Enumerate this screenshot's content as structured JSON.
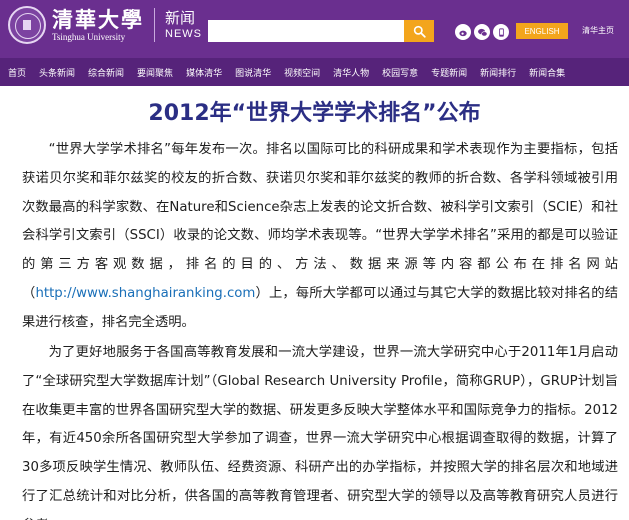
{
  "header": {
    "logo_cn": "清華大學",
    "logo_en": "Tsinghua University",
    "section_cn": "新闻",
    "section_en": "NEWS",
    "search_placeholder": "",
    "english_label": "ENGLISH",
    "home_link": "清华主页",
    "social_icons": [
      "weibo-icon",
      "wechat-icon",
      "mobile-icon"
    ],
    "colors": {
      "brand": "#6a2f8f",
      "nav": "#56237a",
      "accent": "#f3a51c"
    }
  },
  "nav": {
    "items": [
      "首页",
      "头条新闻",
      "综合新闻",
      "要闻聚焦",
      "媒体清华",
      "图说清华",
      "视频空间",
      "清华人物",
      "校园写意",
      "专题新闻",
      "新闻排行",
      "新闻合集"
    ]
  },
  "article": {
    "title": "2012年“世界大学学术排名”公布",
    "p1_before_link": "“世界大学学术排名”每年发布一次。排名以国际可比的科研成果和学术表现作为主要指标，包括获诺贝尔奖和菲尔兹奖的校友的折合数、获诺贝尔奖和菲尔兹奖的教师的折合数、各学科领域被引用次数最高的科学家数、在Nature和Science杂志上发表的论文折合数、被科学引文索引（SCIE）和社会科学引文索引（SSCI）收录的论文数、师均学术表现等。“世界大学学术排名”采用的都是可以验证的第三方客观数据，排名的目的、方法、数据来源等内容都公布在排名网站（",
    "p1_link": "http://www.shanghairanking.com",
    "p1_after_link": "）上，每所大学都可以通过与其它大学的数据比较对排名的结果进行核查，排名完全透明。",
    "p2": "为了更好地服务于各国高等教育发展和一流大学建设，世界一流大学研究中心于2011年1月启动了“全球研究型大学数据库计划”（Global Research University Profile，简称GRUP），GRUP计划旨在收集更丰富的世界各国研究型大学的数据、研发更多反映大学整体水平和国际竞争力的指标。2012年，有近450余所各国研究型大学参加了调查，世界一流大学研究中心根据调查取得的数据，计算了30多项反映学生情况、教师队伍、经费资源、科研产出的办学指标，并按照大学的排名层次和地域进行了汇总统计和对比分析，供各国的高等教育管理者、研究型大学的领导以及高等教育研究人员进行参考。"
  }
}
